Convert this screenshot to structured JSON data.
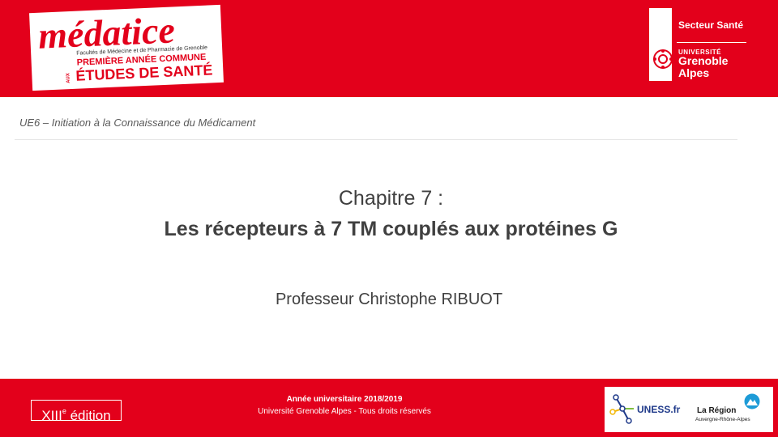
{
  "header": {
    "logo": {
      "brand": "médatice",
      "faculties": "Facultés de Médecine et de Pharmacie de Grenoble",
      "line1": "PREMIÈRE ANNÉE COMMUNE",
      "aux": "AUX",
      "line2": "ÉTUDES DE SANTÉ"
    },
    "university": {
      "sector": "Secteur Santé",
      "univ": "UNIVERSITÉ",
      "grenoble": "Grenoble",
      "alpes": "Alpes"
    }
  },
  "course": "UE6 – Initiation  à la Connaissance du Médicament",
  "slide": {
    "chapter": "Chapitre 7 :",
    "title": "Les récepteurs à 7 TM couplés aux protéines G",
    "author": "Professeur Christophe RIBUOT"
  },
  "footer": {
    "edition_prefix": "XIII",
    "edition_sup": "e",
    "edition_word": " édition",
    "year": "Année universitaire 2018/2019",
    "rights": "Université Grenoble Alpes - Tous droits réservés"
  },
  "partners": {
    "uness": "UNESS.fr",
    "region": "La Région",
    "region_sub": "Auvergne-Rhône-Alpes"
  },
  "colors": {
    "brand_red": "#e3001b",
    "text_gray": "#404040"
  }
}
